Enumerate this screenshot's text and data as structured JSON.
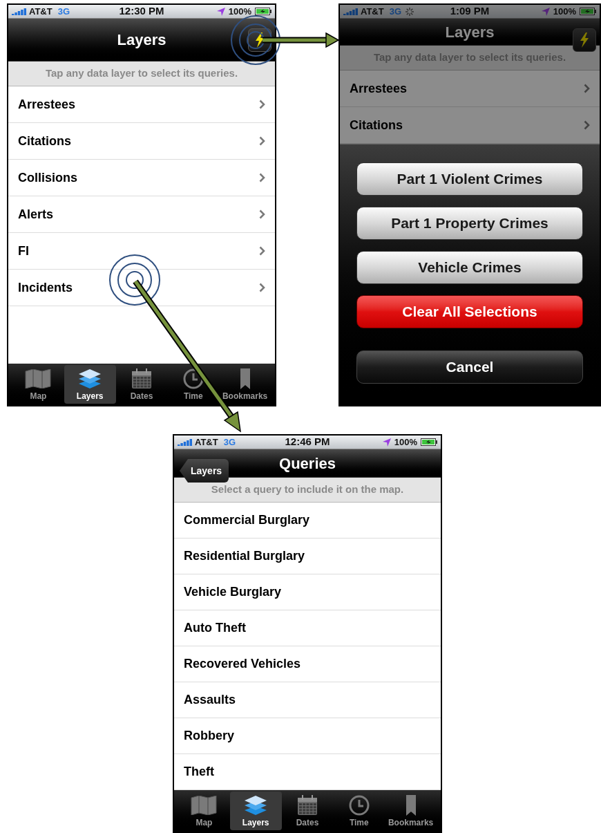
{
  "screens": [
    {
      "status_bar": {
        "carrier": "AT&T",
        "network": "3G",
        "time": "12:30 PM",
        "battery": "100%",
        "busy": false
      },
      "nav_bar": {
        "title": "Layers",
        "action_button": true
      },
      "dimmed": false,
      "hint": "Tap any data layer to select its queries.",
      "rows": [
        {
          "label": "Arrestees",
          "disclosure": true
        },
        {
          "label": "Citations",
          "disclosure": true
        },
        {
          "label": "Collisions",
          "disclosure": true
        },
        {
          "label": "Alerts",
          "disclosure": true
        },
        {
          "label": "FI",
          "disclosure": true
        },
        {
          "label": "Incidents",
          "disclosure": true
        }
      ],
      "tab_bar": [
        {
          "kind": "map",
          "label": "Map",
          "selected": false
        },
        {
          "kind": "layers",
          "label": "Layers",
          "selected": true
        },
        {
          "kind": "dates",
          "label": "Dates",
          "selected": false
        },
        {
          "kind": "time",
          "label": "Time",
          "selected": false
        },
        {
          "kind": "bookmarks",
          "label": "Bookmarks",
          "selected": false
        }
      ]
    },
    {
      "status_bar": {
        "carrier": "AT&T",
        "network": "3G",
        "time": "1:09 PM",
        "battery": "100%",
        "busy": true
      },
      "nav_bar": {
        "title": "Layers",
        "action_button": true
      },
      "dimmed": true,
      "hint": "Tap any data layer to select its queries.",
      "rows": [
        {
          "label": "Arrestees",
          "disclosure": true
        },
        {
          "label": "Citations",
          "disclosure": true
        }
      ],
      "action_sheet": [
        {
          "kind": "default",
          "label": "Part 1 Violent Crimes"
        },
        {
          "kind": "default",
          "label": "Part 1 Property Crimes"
        },
        {
          "kind": "default",
          "label": "Vehicle Crimes"
        },
        {
          "kind": "destructive",
          "label": "Clear All Selections"
        },
        {
          "kind": "cancel",
          "label": "Cancel"
        }
      ]
    },
    {
      "status_bar": {
        "carrier": "AT&T",
        "network": "3G",
        "time": "12:46 PM",
        "battery": "100%",
        "busy": false
      },
      "nav_bar": {
        "title": "Queries",
        "back_button": "Layers",
        "action_button": false
      },
      "dimmed": false,
      "hint": "Select a query to include it on the map.",
      "rows": [
        {
          "label": "Commercial Burglary",
          "disclosure": false
        },
        {
          "label": "Residential Burglary",
          "disclosure": false
        },
        {
          "label": "Vehicle Burglary",
          "disclosure": false
        },
        {
          "label": "Auto Theft",
          "disclosure": false
        },
        {
          "label": "Recovered Vehicles",
          "disclosure": false
        },
        {
          "label": "Assaults",
          "disclosure": false
        },
        {
          "label": "Robbery",
          "disclosure": false
        },
        {
          "label": "Theft",
          "disclosure": false
        }
      ],
      "tab_bar": [
        {
          "kind": "map",
          "label": "Map",
          "selected": false
        },
        {
          "kind": "layers",
          "label": "Layers",
          "selected": true
        },
        {
          "kind": "dates",
          "label": "Dates",
          "selected": false
        },
        {
          "kind": "time",
          "label": "Time",
          "selected": false
        },
        {
          "kind": "bookmarks",
          "label": "Bookmarks",
          "selected": false
        }
      ]
    }
  ]
}
